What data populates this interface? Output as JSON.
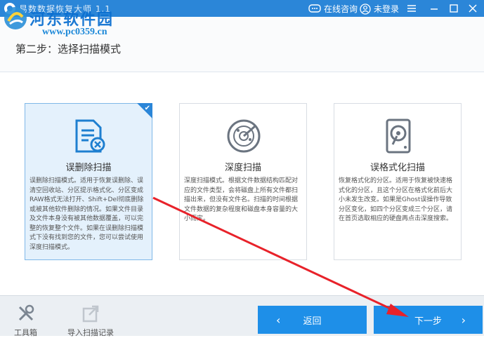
{
  "titlebar": {
    "app_title": "易数数据恢复大师 1.1",
    "online_consult": "在线咨询",
    "login": "未登录"
  },
  "watermark": {
    "site_name": "河东软件园",
    "url": "www.pc0359.cn"
  },
  "step_title": "第二步：选择扫描模式",
  "cards": [
    {
      "name": "误删除扫描",
      "icon": "document-delete-icon",
      "selected": true,
      "desc": "误删除扫描模式。适用于恢复误删除、误清空回收站、分区提示格式化、分区变成RAW格式无法打开、Shift+Del彻底删除或被其他软件删除的情况。如果文件目录及文件本身没有被其他数据覆盖，可以完整的恢复整个文件。如果在误删除扫描模式下没有找到您的文件，您可以尝试使用深度扫描模式。"
    },
    {
      "name": "深度扫描",
      "icon": "radar-icon",
      "selected": false,
      "desc": "深度扫描模式。根据文件数据结构匹配对应的文件类型，会将磁盘上所有文件都扫描出来，但没有文件名。扫描的时间根据文件数据的复杂程度和磁盘本身容量的大小而定。"
    },
    {
      "name": "误格式化扫描",
      "icon": "hard-disk-icon",
      "selected": false,
      "desc": "恢复格式化的分区。适用于恢复被快速格式化的分区，且这个分区在格式化前后大小未发生改变。如果是Ghost误操作导致分区变化，如四个分区变成三个分区，请在首页选取相应的硬盘再点击深度搜索。"
    }
  ],
  "footer": {
    "toolbox": "工具箱",
    "import_record": "导入扫描记录",
    "back": "返回",
    "next": "下一步"
  },
  "colors": {
    "accent": "#2b86d8",
    "button": "#1e8fe8",
    "annotation_arrow": "#e8222a"
  }
}
